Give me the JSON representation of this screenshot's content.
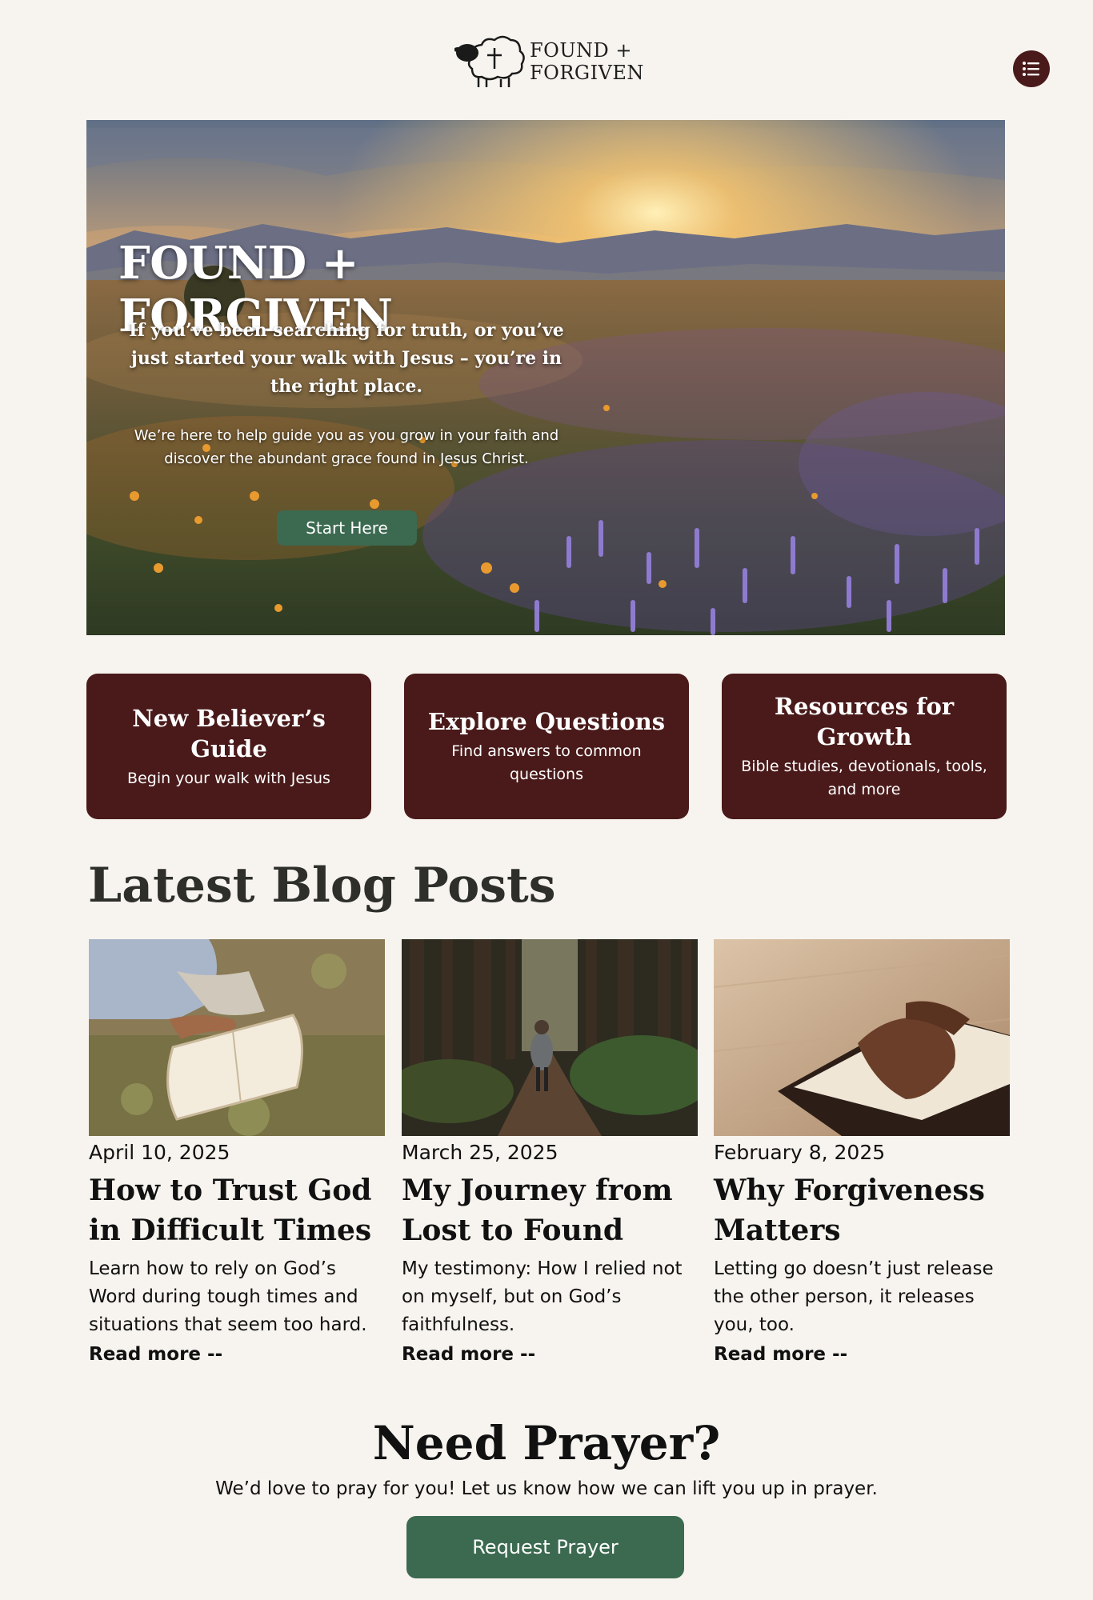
{
  "header": {
    "logo_line1": "FOUND +",
    "logo_line2": "FORGIVEN",
    "menu_icon": "list-icon"
  },
  "hero": {
    "title": "FOUND + FORGIVEN",
    "subtitle": "If you’ve been searching for truth, or you’ve just started your walk with Jesus – you’re in the right place.",
    "body": "We’re here to help guide you as you grow in your faith and discover the abundant grace found in Jesus Christ.",
    "button": "Start Here"
  },
  "cards": [
    {
      "title": "New Believer’s Guide",
      "desc": "Begin your walk with Jesus"
    },
    {
      "title": "Explore Questions",
      "desc": "Find answers to common questions"
    },
    {
      "title": "Resources for Growth",
      "desc": "Bible studies, devotionals, tools, and more"
    }
  ],
  "blog": {
    "heading": "Latest Blog Posts",
    "posts": [
      {
        "date": "April 10, 2025",
        "title": "How to Trust God in Difficult Times",
        "excerpt": "Learn how to rely on God’s Word during tough times and situations that seem too hard.",
        "link": "Read more --"
      },
      {
        "date": "March 25, 2025",
        "title": "My Journey from Lost to Found",
        "excerpt": "My testimony: How I relied not on myself, but on God’s faithfulness.",
        "link": "Read more --"
      },
      {
        "date": "February 8, 2025",
        "title": "Why Forgiveness Matters",
        "excerpt": "Letting go doesn’t just release the other person, it releases you, too.",
        "link": "Read more --"
      }
    ]
  },
  "prayer": {
    "heading": "Need Prayer?",
    "text": "We’d love to pray for you!  Let us know how we can lift you up in prayer.",
    "button": "Request Prayer"
  },
  "colors": {
    "background": "#f7f4ef",
    "maroon": "#4a1a1a",
    "green": "#3b6a50"
  }
}
